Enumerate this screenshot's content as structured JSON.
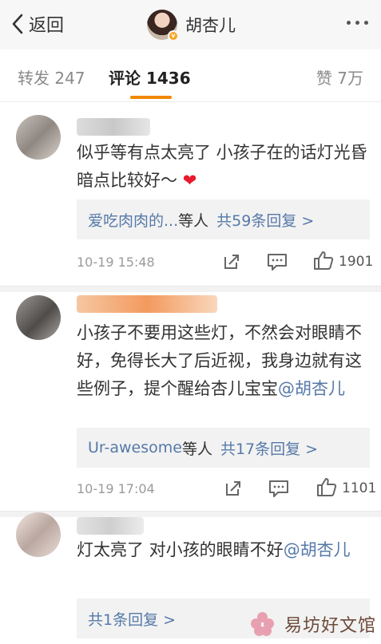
{
  "colors": {
    "accent": "#f18800",
    "link": "#5679a8",
    "heart": "#e8192c",
    "background": "#ffffff",
    "reply_background": "#f2f2f2"
  },
  "header": {
    "back_label": "返回",
    "profile_name": "胡杏儿",
    "verified_badge": "v",
    "icons": {
      "back": "chevron-left-icon",
      "more": "more-dots-icon"
    }
  },
  "tabs": {
    "repost": "转发 247",
    "comments": "评论 1436",
    "likes": "赞 7万"
  },
  "comments": [
    {
      "text": "似乎等有点太亮了 小孩子在的话灯光昏暗点比较好～",
      "emoji": "❤",
      "reply_users": "爱吃肉肉的...",
      "reply_mid": "等人",
      "reply_total": "共59条回复 >",
      "time": "10-19 15:48",
      "likes": "1901"
    },
    {
      "text": "小孩子不要用这些灯，不然会对眼睛不好，免得长大了后近视，我身边就有这些例子，提个醒给杏儿宝宝",
      "mention": "@胡杏儿",
      "reply_users": "Ur-awesome",
      "reply_mid": "等人",
      "reply_total": "共17条回复 >",
      "time": "10-19 17:04",
      "likes": "1101"
    },
    {
      "text": "灯太亮了  对小孩的眼睛不好",
      "mention": "@胡杏儿",
      "reply_total": "共1条回复 >"
    }
  ],
  "watermark": {
    "text": "易坊好文馆"
  }
}
